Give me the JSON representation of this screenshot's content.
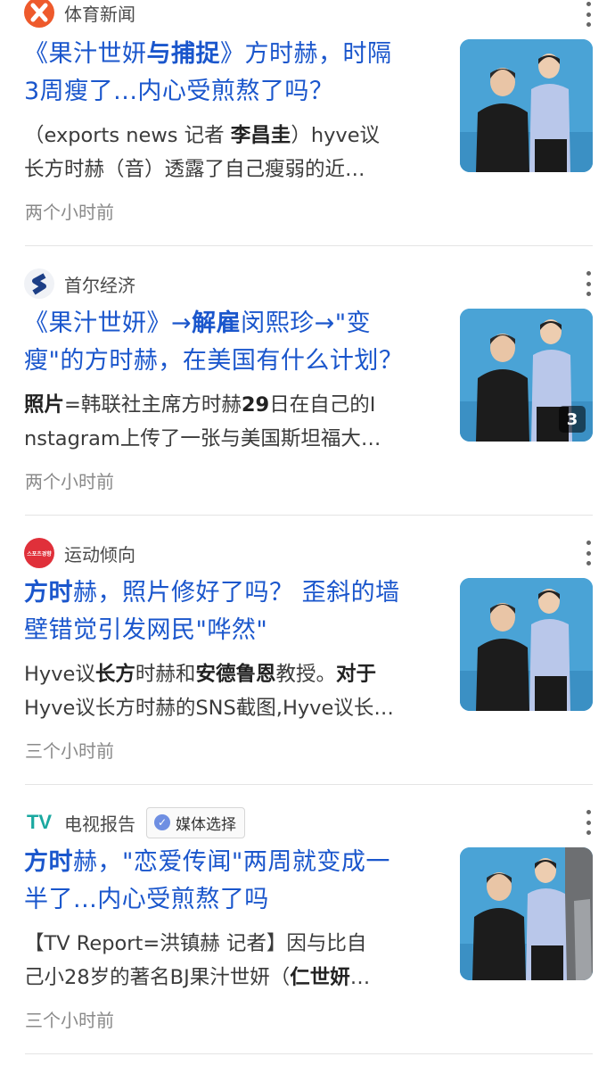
{
  "colors": {
    "title_link": "#1a56cc",
    "source_text": "#4a4a4a",
    "time_text": "#8a8a8a",
    "divider": "#e4e4e4",
    "thumb_bg": "#4aa3d6"
  },
  "articles": [
    {
      "source": "体育新闻",
      "logo_icon": "x-logo-icon",
      "title_lines": [
        [
          {
            "t": "《果汁世妍",
            "b": false
          },
          {
            "t": "与捕捉",
            "b": true
          },
          {
            "t": "》方时赫，时隔",
            "b": false
          }
        ],
        [
          {
            "t": "3周瘦了...内心受煎熬了吗？",
            "b": false
          }
        ]
      ],
      "snippet_lines": [
        [
          {
            "t": "（exports news 记者 ",
            "b": false
          },
          {
            "t": "李昌圭",
            "b": true
          },
          {
            "t": "）hyve议",
            "b": false
          }
        ],
        [
          {
            "t": "长方时赫（音）透露了自己瘦弱的近…",
            "b": false
          }
        ]
      ],
      "time": "两个小时前"
    },
    {
      "source": "首尔经济",
      "logo_icon": "s-logo-icon",
      "title_lines": [
        [
          {
            "t": "《果汁世妍》→",
            "b": false
          },
          {
            "t": "解雇",
            "b": true
          },
          {
            "t": "闵熙珍→\"变",
            "b": false
          }
        ],
        [
          {
            "t": "瘦\"的方时赫，在美国有什么计划？",
            "b": false
          }
        ]
      ],
      "snippet_lines": [
        [
          {
            "t": "照片",
            "b": true
          },
          {
            "t": "=韩联社主席方时赫",
            "b": false
          },
          {
            "t": "29",
            "b": true
          },
          {
            "t": "日在自己的I",
            "b": false
          }
        ],
        [
          {
            "t": "nstagram上传了一张与美国斯坦福大…",
            "b": false
          }
        ]
      ],
      "time": "两个小时前",
      "photo_count": "3"
    },
    {
      "source": "运动倾向",
      "logo_icon": "sports-logo-icon",
      "logo_text": "스포츠경향",
      "title_lines": [
        [
          {
            "t": "方时",
            "b": true
          },
          {
            "t": "赫，照片修好了吗？ 歪斜的墙",
            "b": false
          }
        ],
        [
          {
            "t": "壁错觉引发网民\"哗然\"",
            "b": false
          }
        ]
      ],
      "snippet_lines": [
        [
          {
            "t": "Hyve议",
            "b": false
          },
          {
            "t": "长方",
            "b": true
          },
          {
            "t": "时赫和",
            "b": false
          },
          {
            "t": "安德鲁恩",
            "b": true
          },
          {
            "t": "教授。",
            "b": false
          },
          {
            "t": "对于",
            "b": true
          }
        ],
        [
          {
            "t": "Hyve议长方时赫的SNS截图,Hyve议长…",
            "b": false
          }
        ]
      ],
      "time": "三个小时前"
    },
    {
      "source": "电视报告",
      "logo_icon": "tv-logo-icon",
      "logo_text": "TV",
      "badge": "媒体选择",
      "badge_icon": "check-icon",
      "title_lines": [
        [
          {
            "t": "方时",
            "b": true
          },
          {
            "t": "赫，\"恋爱传闻\"两周就变成一",
            "b": false
          }
        ],
        [
          {
            "t": "半了...内心受煎熬了吗",
            "b": false
          }
        ]
      ],
      "snippet_lines": [
        [
          {
            "t": "【TV Report=洪镇赫 记者】因与比自",
            "b": false
          }
        ],
        [
          {
            "t": "己小28岁的著名BJ果汁世妍（",
            "b": false
          },
          {
            "t": "仁世妍",
            "b": true
          },
          {
            "t": "…",
            "b": false
          }
        ]
      ],
      "time": "三个小时前"
    }
  ]
}
